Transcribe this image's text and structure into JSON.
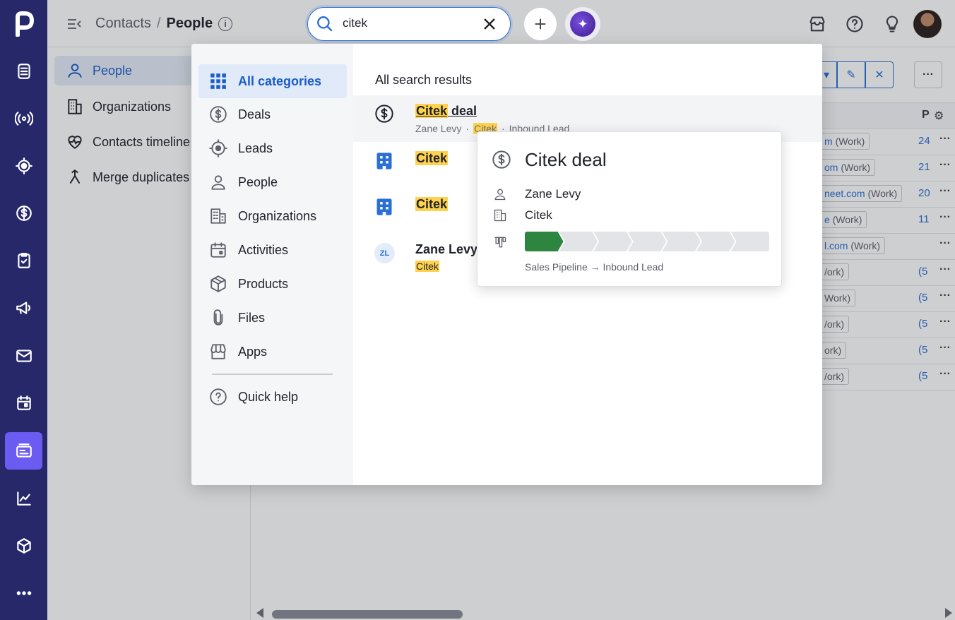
{
  "header": {
    "breadcrumb_parent": "Contacts",
    "breadcrumb_sep": "/",
    "breadcrumb_current": "People",
    "info_icon": "i"
  },
  "search": {
    "value": "citek",
    "placeholder": ""
  },
  "sidenav": {
    "items": [
      {
        "label": "People",
        "icon": "person-icon"
      },
      {
        "label": "Organizations",
        "icon": "building-icon"
      },
      {
        "label": "Contacts timeline",
        "icon": "heart-pulse-icon"
      },
      {
        "label": "Merge duplicates",
        "icon": "merge-icon"
      }
    ]
  },
  "table": {
    "header_col": "P",
    "rows": [
      {
        "email": "m",
        "tag": "(Work)",
        "num": "24"
      },
      {
        "email": "om",
        "tag": "(Work)",
        "num": "21"
      },
      {
        "email": "neet.com",
        "tag": "(Work)",
        "num": "20"
      },
      {
        "email": "e",
        "tag": "(Work)",
        "num": "11"
      },
      {
        "email": "l.com",
        "tag": "(Work)",
        "num": ""
      },
      {
        "email": "",
        "tag": "/ork)",
        "num": "(5"
      },
      {
        "email": "",
        "tag": "Work)",
        "num": "(5"
      },
      {
        "email": "",
        "tag": "/ork)",
        "num": "(5"
      },
      {
        "email": "",
        "tag": "ork)",
        "num": "(5"
      },
      {
        "email": "",
        "tag": "/ork)",
        "num": "(5"
      }
    ]
  },
  "categories": [
    {
      "label": "All categories",
      "icon": "grid-icon",
      "selected": true
    },
    {
      "label": "Deals",
      "icon": "dollar-icon"
    },
    {
      "label": "Leads",
      "icon": "target-icon"
    },
    {
      "label": "People",
      "icon": "person-icon"
    },
    {
      "label": "Organizations",
      "icon": "building-icon"
    },
    {
      "label": "Activities",
      "icon": "calendar-icon"
    },
    {
      "label": "Products",
      "icon": "box-icon"
    },
    {
      "label": "Files",
      "icon": "paperclip-icon"
    },
    {
      "label": "Apps",
      "icon": "store-icon"
    },
    {
      "label": "Quick help",
      "icon": "question-icon"
    }
  ],
  "results": {
    "heading": "All search results",
    "items": [
      {
        "type": "deal",
        "title_hl": "Citek",
        "title_rest": " deal",
        "sub_person": "Zane Levy",
        "sub_org_hl": "Citek",
        "sub_stage": "Inbound Lead",
        "dot": "·"
      },
      {
        "type": "organization",
        "title_hl": "Citek"
      },
      {
        "type": "organization",
        "title_hl": "Citek"
      },
      {
        "type": "person",
        "initials": "ZL",
        "title": "Zane Levy",
        "sub_hl": "Citek"
      }
    ]
  },
  "preview": {
    "title": "Citek deal",
    "person": "Zane Levy",
    "organization": "Citek",
    "pipeline": "Sales Pipeline → Inbound Lead",
    "stages_total": 7,
    "stages_done": 1,
    "stage_color": "#2e8540"
  },
  "colors": {
    "rail": "#26286a",
    "accent": "#1a5cc8",
    "highlight": "#ffd24d",
    "active_rail": "#6b5bf0"
  }
}
